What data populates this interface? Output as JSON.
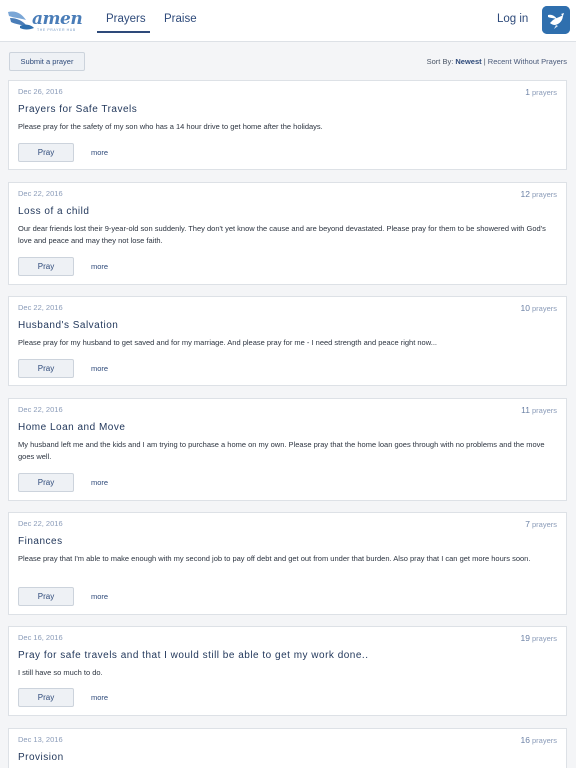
{
  "header": {
    "logo_word": "amen",
    "logo_tagline": "THE PRAYER HUB",
    "tabs": [
      {
        "label": "Prayers",
        "active": true
      },
      {
        "label": "Praise",
        "active": false
      }
    ],
    "login_label": "Log in",
    "app_icon": "dove-icon"
  },
  "toolbar": {
    "submit_label": "Submit a prayer",
    "sort_prefix": "Sort By:",
    "sort_active": "Newest",
    "sort_separator": "|",
    "sort_other": "Recent Without Prayers"
  },
  "card_labels": {
    "prayers_unit": "prayers",
    "pray_label": "Pray",
    "more_label": "more"
  },
  "prayers": [
    {
      "date": "Dec 26, 2016",
      "count": "1",
      "title": "Prayers for Safe Travels",
      "body": "Please pray for the safety of my son who has a 14 hour drive to get home after the holidays."
    },
    {
      "date": "Dec 22, 2016",
      "count": "12",
      "title": "Loss of a child",
      "body": "Our dear friends lost their 9-year-old son suddenly. They don't yet know the cause and are beyond devastated. Please pray for them to be showered with God's love and peace and may they not lose faith."
    },
    {
      "date": "Dec 22, 2016",
      "count": "10",
      "title": "Husband's Salvation",
      "body": "Please pray for my husband to get saved and for my marriage. And please pray for me - I need strength and peace right now..."
    },
    {
      "date": "Dec 22, 2016",
      "count": "11",
      "title": "Home Loan and Move",
      "body": "My husband left me and the kids and I am trying to purchase a home on my own. Please pray that the home loan goes through with no problems and the move goes well."
    },
    {
      "date": "Dec 22, 2016",
      "count": "7",
      "title": "Finances",
      "body": "Please pray that I'm able to make enough with my second job to pay off debt and get out from under that burden. Also pray that I can get more hours soon."
    },
    {
      "date": "Dec 16, 2016",
      "count": "19",
      "title": "Pray for safe travels and that I would still be able to get my work done..",
      "body": "I still have so much to do."
    },
    {
      "date": "Dec 13, 2016",
      "count": "16",
      "title": "Provision",
      "body": ""
    }
  ],
  "colors": {
    "brand": "#2e4a7a",
    "accent": "#4a7db8",
    "muted": "#8a9bb8",
    "background": "#f4f5f7",
    "card_border": "#dde1e6"
  }
}
